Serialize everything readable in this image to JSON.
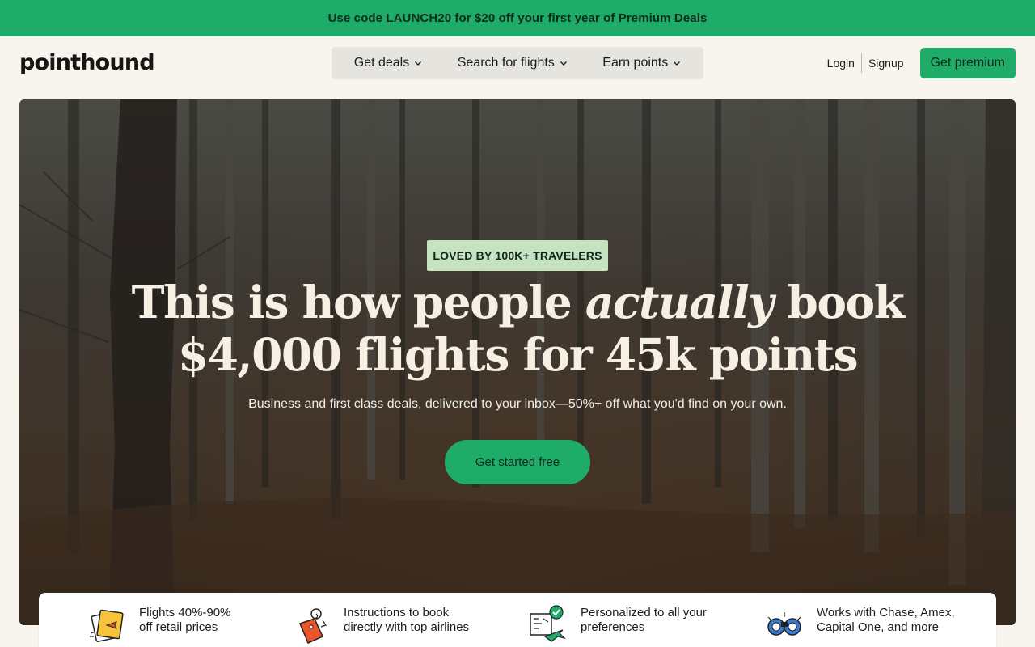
{
  "promo": {
    "text": "Use code LAUNCH20 for $20 off your first year of Premium Deals"
  },
  "header": {
    "logo": "pointhound",
    "nav": [
      {
        "label": "Get deals",
        "icon": "chevron-down-icon"
      },
      {
        "label": "Search for flights",
        "icon": "chevron-down-icon"
      },
      {
        "label": "Earn points",
        "icon": "chevron-down-icon"
      }
    ],
    "login": "Login",
    "signup": "Signup",
    "premium": "Get premium"
  },
  "hero": {
    "badge": "LOVED BY 100K+ TRAVELERS",
    "headline_part1": "This is how people ",
    "headline_em": "actually",
    "headline_part2": " book",
    "headline_line2": "$4,000 flights for 45k points",
    "subline": "Business and first class deals, delivered to your inbox—50%+ off what you'd find on your own.",
    "cta": "Get started free"
  },
  "features": [
    {
      "line1": "Flights 40%-90%",
      "line2": "off retail prices",
      "icon": "ticket-plane-icon"
    },
    {
      "line1": "Instructions to book",
      "line2": "directly with top airlines",
      "icon": "luggage-tag-icon"
    },
    {
      "line1": "Personalized to all your",
      "line2": "preferences",
      "icon": "map-checkmark-icon"
    },
    {
      "line1": "Works with Chase, Amex,",
      "line2": "Capital One, and more",
      "icon": "binoculars-icon"
    }
  ],
  "colors": {
    "brand_green": "#1fac69",
    "badge_green": "#c6e3c1",
    "page_bg": "#f8f5ee"
  }
}
